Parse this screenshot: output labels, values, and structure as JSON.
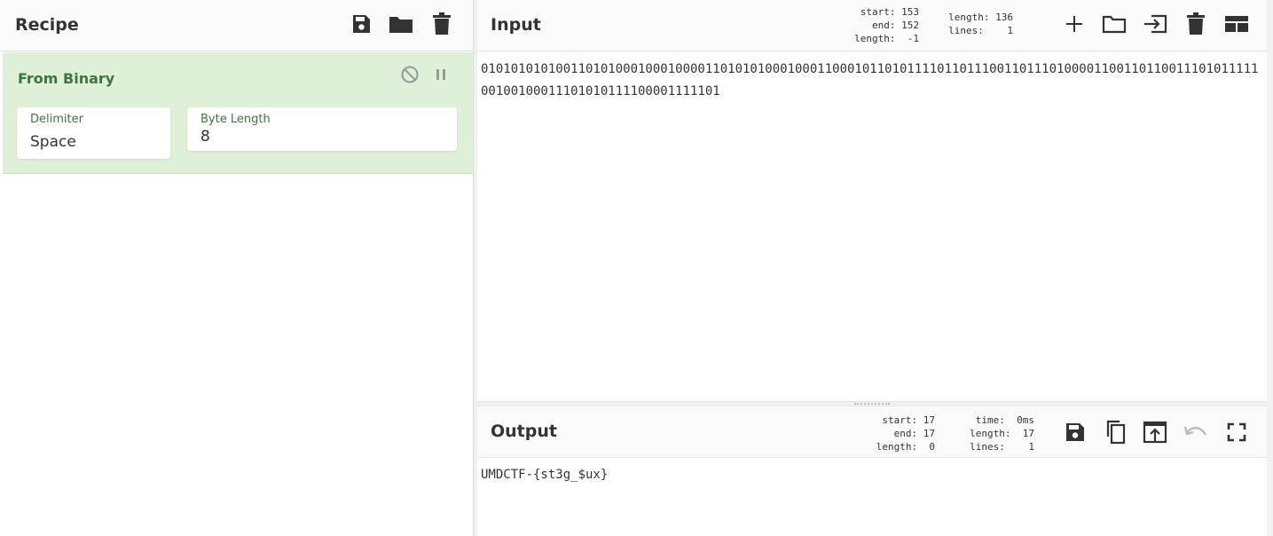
{
  "recipe": {
    "title": "Recipe",
    "operation": {
      "name": "From Binary",
      "args": [
        {
          "label": "Delimiter",
          "value": "Space"
        },
        {
          "label": "Byte Length",
          "value": "8"
        }
      ]
    }
  },
  "input": {
    "title": "Input",
    "stats": {
      "start_label": "start:",
      "start": "153",
      "end_label": "end:",
      "end": "152",
      "length_label": "length:",
      "length": "-1",
      "total_length_label": "length:",
      "total_length": "136",
      "lines_label": "lines:",
      "lines": "1"
    },
    "text": "0101010101001101010001000100001101010100010001100010110101111011011100110111010000110011011001110101111100100100011101010111100001111101"
  },
  "output": {
    "title": "Output",
    "stats": {
      "start_label": "start:",
      "start": "17",
      "end_label": "end:",
      "end": "17",
      "length_label": "length:",
      "length": "0",
      "time_label": "time:",
      "time": "0ms",
      "total_length_label": "length:",
      "total_length": "17",
      "lines_label": "lines:",
      "lines": "1"
    },
    "text": "UMDCTF-{st3g_$ux}"
  },
  "icons": {
    "save": "save-icon",
    "open": "folder-icon",
    "clear": "trash-icon",
    "disable": "disable-icon",
    "pause": "pause-icon",
    "add": "plus-icon",
    "open_file": "folder-open-icon",
    "insert": "input-arrow-icon",
    "layout": "layout-icon",
    "copy": "copy-icon",
    "replace_input": "upload-icon",
    "undo": "undo-icon",
    "maximise": "fullscreen-icon"
  },
  "colors": {
    "operation_bg": "#dff0d8",
    "operation_text": "#3c763d",
    "icon": "#333333",
    "icon_disabled": "#bbbbbb"
  }
}
